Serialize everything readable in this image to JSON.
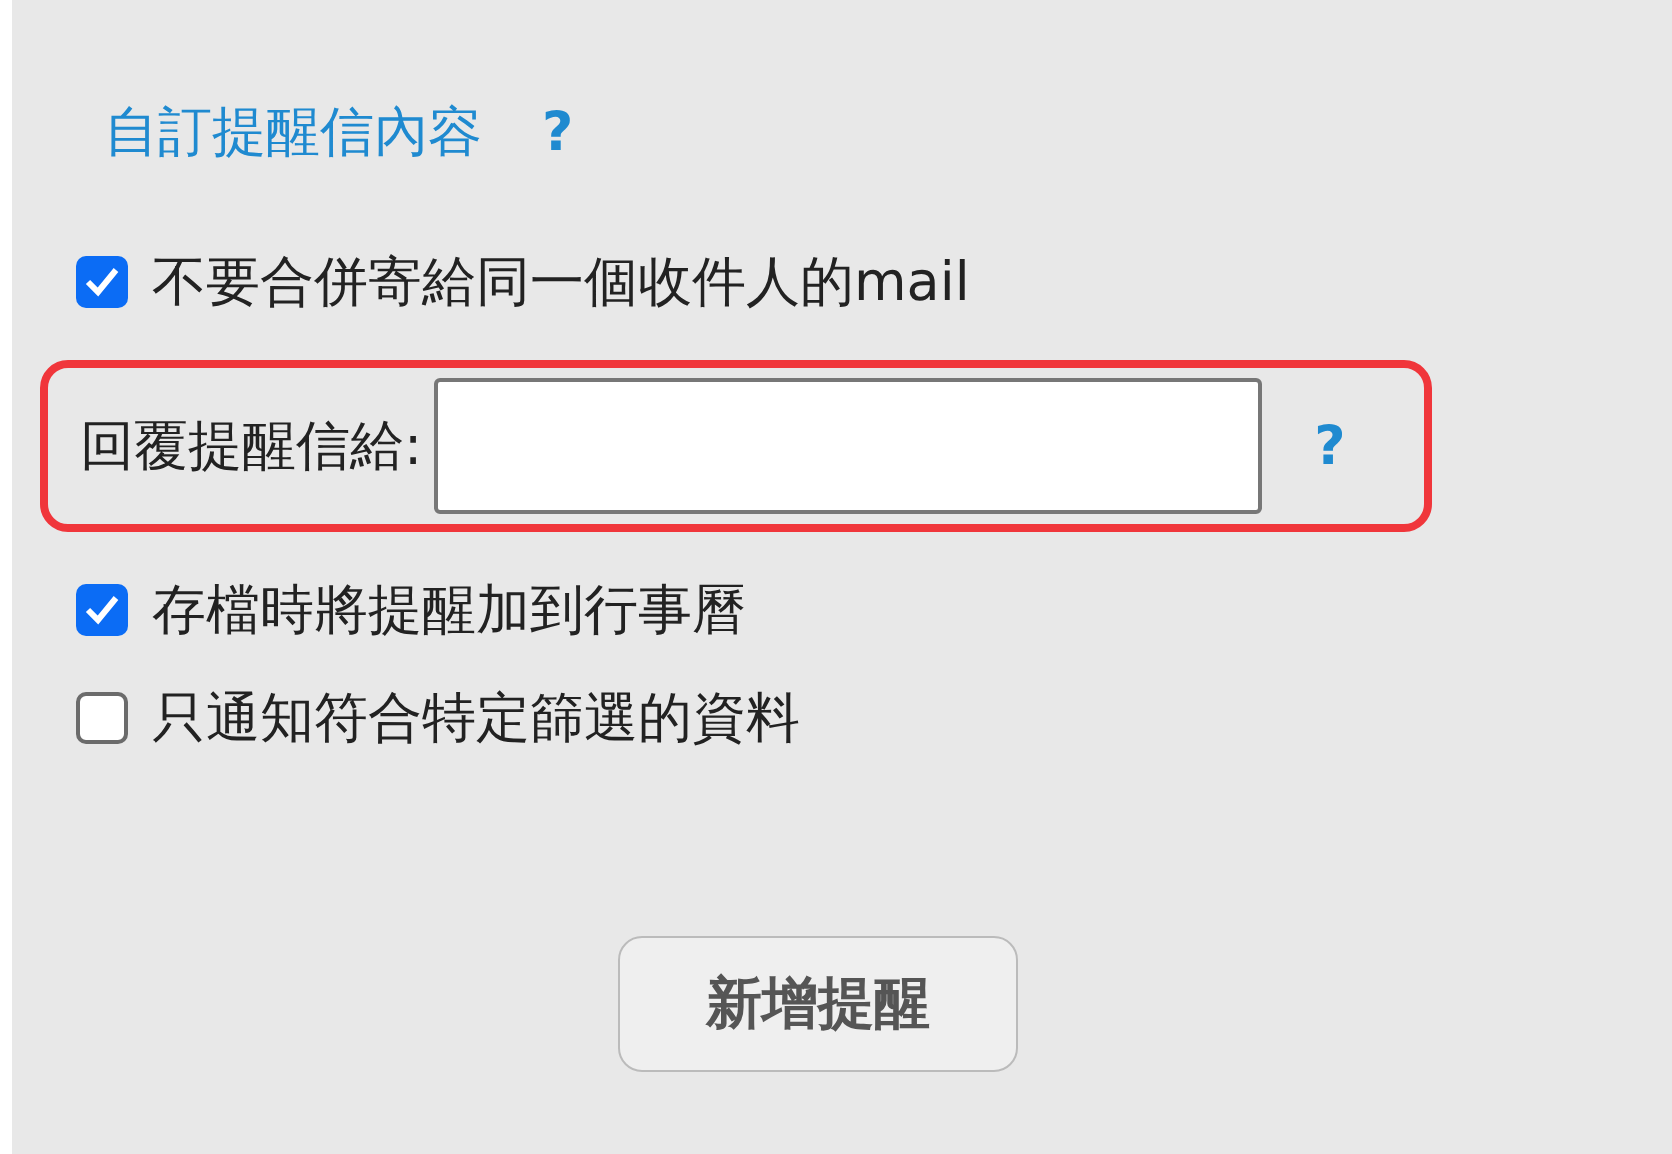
{
  "heading": {
    "label": "自訂提醒信內容",
    "help": "?"
  },
  "options": [
    {
      "kind": "checkbox",
      "label": "不要合併寄給同一個收件人的mail",
      "checked": true
    },
    {
      "kind": "field",
      "label": "回覆提醒信給:",
      "help": "?",
      "highlighted": true
    },
    {
      "kind": "checkbox",
      "label": "存檔時將提醒加到行事曆",
      "checked": true
    },
    {
      "kind": "checkbox",
      "label": "只通知符合特定篩選的資料",
      "checked": false
    }
  ],
  "button": "新增提醒"
}
